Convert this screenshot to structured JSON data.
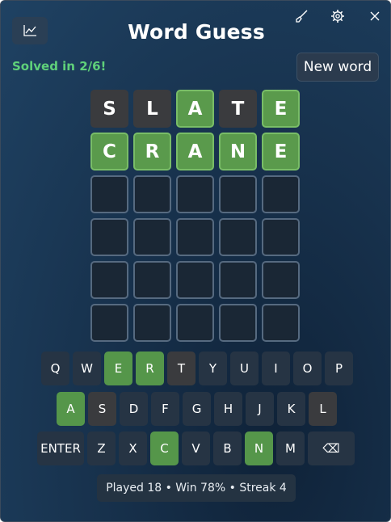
{
  "app": {
    "title": "Word Guess"
  },
  "status": {
    "solved_text": "Solved in 2/6!"
  },
  "actions": {
    "new_word_label": "New word"
  },
  "icons": {
    "stats": "chart-line-icon",
    "brush": "brush-icon",
    "settings": "gear-icon",
    "close": "close-icon",
    "backspace": "backspace-icon"
  },
  "board": {
    "rows": [
      [
        {
          "letter": "S",
          "state": "absent"
        },
        {
          "letter": "L",
          "state": "absent"
        },
        {
          "letter": "A",
          "state": "correct"
        },
        {
          "letter": "T",
          "state": "absent"
        },
        {
          "letter": "E",
          "state": "correct"
        }
      ],
      [
        {
          "letter": "C",
          "state": "correct"
        },
        {
          "letter": "R",
          "state": "correct"
        },
        {
          "letter": "A",
          "state": "correct"
        },
        {
          "letter": "N",
          "state": "correct"
        },
        {
          "letter": "E",
          "state": "correct"
        }
      ],
      [
        {
          "letter": "",
          "state": "empty"
        },
        {
          "letter": "",
          "state": "empty"
        },
        {
          "letter": "",
          "state": "empty"
        },
        {
          "letter": "",
          "state": "empty"
        },
        {
          "letter": "",
          "state": "empty"
        }
      ],
      [
        {
          "letter": "",
          "state": "empty"
        },
        {
          "letter": "",
          "state": "empty"
        },
        {
          "letter": "",
          "state": "empty"
        },
        {
          "letter": "",
          "state": "empty"
        },
        {
          "letter": "",
          "state": "empty"
        }
      ],
      [
        {
          "letter": "",
          "state": "empty"
        },
        {
          "letter": "",
          "state": "empty"
        },
        {
          "letter": "",
          "state": "empty"
        },
        {
          "letter": "",
          "state": "empty"
        },
        {
          "letter": "",
          "state": "empty"
        }
      ],
      [
        {
          "letter": "",
          "state": "empty"
        },
        {
          "letter": "",
          "state": "empty"
        },
        {
          "letter": "",
          "state": "empty"
        },
        {
          "letter": "",
          "state": "empty"
        },
        {
          "letter": "",
          "state": "empty"
        }
      ]
    ]
  },
  "keyboard": {
    "rows": [
      [
        {
          "label": "Q",
          "state": "unused"
        },
        {
          "label": "W",
          "state": "unused"
        },
        {
          "label": "E",
          "state": "correct"
        },
        {
          "label": "R",
          "state": "correct"
        },
        {
          "label": "T",
          "state": "absent"
        },
        {
          "label": "Y",
          "state": "unused"
        },
        {
          "label": "U",
          "state": "unused"
        },
        {
          "label": "I",
          "state": "unused"
        },
        {
          "label": "O",
          "state": "unused"
        },
        {
          "label": "P",
          "state": "unused"
        }
      ],
      [
        {
          "label": "A",
          "state": "correct"
        },
        {
          "label": "S",
          "state": "absent"
        },
        {
          "label": "D",
          "state": "unused"
        },
        {
          "label": "F",
          "state": "unused"
        },
        {
          "label": "G",
          "state": "unused"
        },
        {
          "label": "H",
          "state": "unused"
        },
        {
          "label": "J",
          "state": "unused"
        },
        {
          "label": "K",
          "state": "unused"
        },
        {
          "label": "L",
          "state": "absent"
        }
      ],
      [
        {
          "label": "ENTER",
          "state": "unused"
        },
        {
          "label": "Z",
          "state": "unused"
        },
        {
          "label": "X",
          "state": "unused"
        },
        {
          "label": "C",
          "state": "correct"
        },
        {
          "label": "V",
          "state": "unused"
        },
        {
          "label": "B",
          "state": "unused"
        },
        {
          "label": "N",
          "state": "correct"
        },
        {
          "label": "M",
          "state": "unused"
        },
        {
          "label": "⌫",
          "state": "unused"
        }
      ]
    ]
  },
  "footer": {
    "stats_text": "Played 18 • Win 78% • Streak 4"
  },
  "colors": {
    "correct": "#5a9a4c",
    "absent": "#3a3b3e",
    "key_unused": "#263444",
    "solved_text": "#5fd07a"
  }
}
